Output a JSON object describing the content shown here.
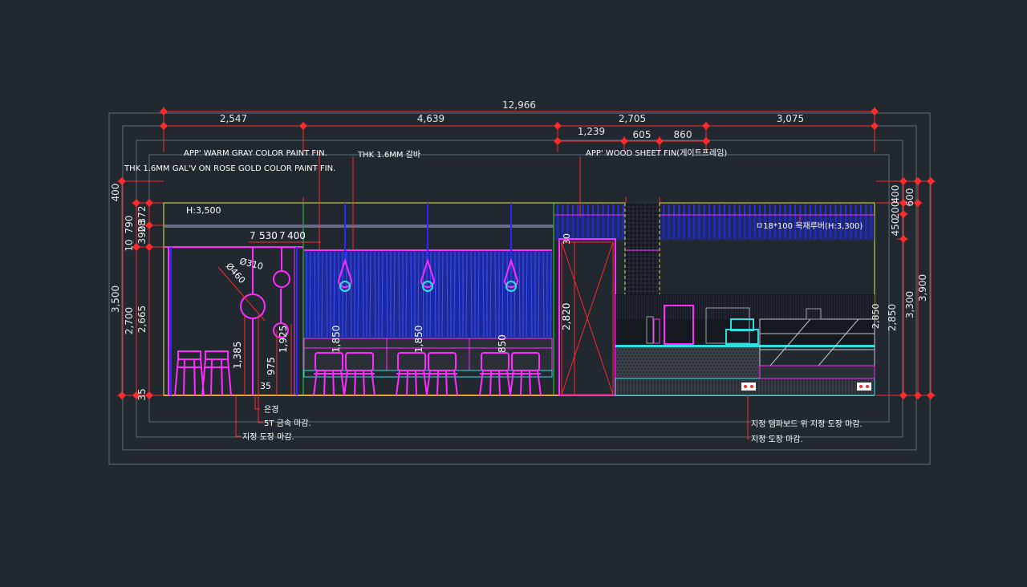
{
  "colors": {
    "background": "#212830",
    "frame": "#5a6e7a",
    "dimension": "#ff2a2a",
    "magenta": "#ff2cff",
    "blue": "#2a2aff",
    "yellow": "#e8e84a",
    "green": "#30d040",
    "cyan": "#30e0e0",
    "white": "#e6e6e6"
  },
  "dimensions": {
    "overall": "12,966",
    "seg_a": "2,547",
    "seg_b": "4,639",
    "seg_c": "2,705",
    "seg_d": "3,075",
    "sub_a": "1,239",
    "sub_b": "605",
    "sub_c": "860",
    "left_outer": "3,500",
    "left_top": "400",
    "left_790": "790",
    "left_10": "10",
    "left_2700": "2,700",
    "left_35": "35",
    "left_372": "372",
    "left_28": "28",
    "left_390": "390",
    "left_2665": "2,665",
    "right_outer": "3,900",
    "right_600": "600",
    "right_3300": "3,300",
    "right_400": "400",
    "right_200": "200",
    "right_450": "450",
    "right_2850": "2,850",
    "d530_7": "7",
    "d530": "530",
    "d400_7": "7",
    "d400": "400",
    "dia310": "Ø310",
    "dia460": "Ø460",
    "h1385": "1,385",
    "h1925": "1,925",
    "h975": "975",
    "h35": "35",
    "h1850_a": "1,850",
    "h1850_b": "1,850",
    "h1850_c": "850",
    "h2820": "2,820",
    "h30": "30"
  },
  "labels": {
    "app_gray": "APP' WARM GRAY COLOR PAINT FIN.",
    "thk_gal": "THK 1.6MM GAL'V ON ROSE GOLD COLOR PAINT FIN.",
    "thk_galba": "THK 1.6MM 갈바",
    "app_wood": "APP' WOOD SHEET FIN(게이트프레임)",
    "h3500": "H:3,500",
    "louver": "ㅁ18*100 목재루버(H:3,300)",
    "eungyeong": "은경",
    "metal_5t": "5T 금속 마감.",
    "paint": "지정 도장 마감.",
    "tempa": "지정 템파보드 위 지정 도장 마감.",
    "paint2": "지정 도장 마감."
  }
}
